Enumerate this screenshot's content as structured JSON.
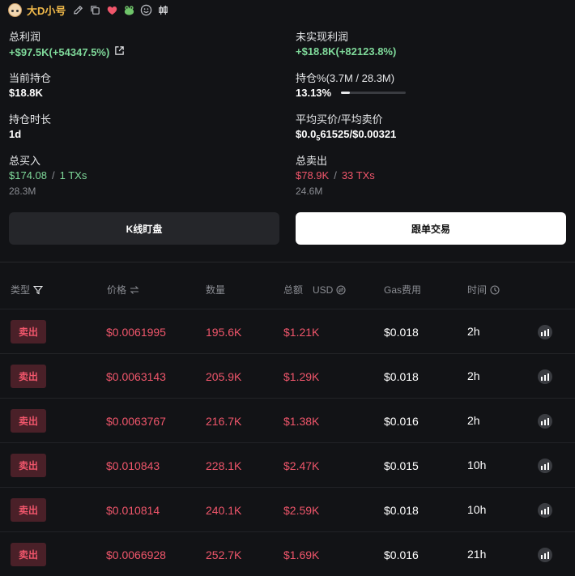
{
  "header": {
    "username": "大D小号"
  },
  "stats": {
    "total_profit": {
      "label": "总利润",
      "value": "+$97.5K(+54347.5%)"
    },
    "unrealized_profit": {
      "label": "未实现利润",
      "value": "+$18.8K(+82123.8%)"
    },
    "holding": {
      "label": "当前持仓",
      "value": "$18.8K"
    },
    "holding_pct": {
      "label_main": "持仓%",
      "label_detail": "(3.7M / 28.3M)",
      "value": "13.13%",
      "fraction": 0.1313
    },
    "hold_duration": {
      "label": "持仓时长",
      "value": "1d"
    },
    "avg_price": {
      "label": "平均买价/平均卖价",
      "value_prefix": "$0.0",
      "value_sub": "5",
      "value_rest": "61525/$0.00321"
    },
    "total_buy": {
      "label": "总买入",
      "amount": "$174.08",
      "sep": "/",
      "txs": "1 TXs",
      "qty": "28.3M"
    },
    "total_sell": {
      "label": "总卖出",
      "amount": "$78.9K",
      "sep": "/",
      "txs": "33 TXs",
      "qty": "24.6M"
    }
  },
  "buttons": {
    "kline": "K线盯盘",
    "copy_trade": "跟单交易"
  },
  "table": {
    "headers": {
      "type": "类型",
      "price": "价格",
      "amount": "数量",
      "total": "总额",
      "total_unit": "USD",
      "gas": "Gas费用",
      "time": "时间"
    },
    "rows": [
      {
        "type": "卖出",
        "price": "$0.0061995",
        "amount": "195.6K",
        "total": "$1.21K",
        "gas": "$0.018",
        "time": "2h"
      },
      {
        "type": "卖出",
        "price": "$0.0063143",
        "amount": "205.9K",
        "total": "$1.29K",
        "gas": "$0.018",
        "time": "2h"
      },
      {
        "type": "卖出",
        "price": "$0.0063767",
        "amount": "216.7K",
        "total": "$1.38K",
        "gas": "$0.016",
        "time": "2h"
      },
      {
        "type": "卖出",
        "price": "$0.010843",
        "amount": "228.1K",
        "total": "$2.47K",
        "gas": "$0.015",
        "time": "10h"
      },
      {
        "type": "卖出",
        "price": "$0.010814",
        "amount": "240.1K",
        "total": "$2.59K",
        "gas": "$0.018",
        "time": "10h"
      },
      {
        "type": "卖出",
        "price": "$0.0066928",
        "amount": "252.7K",
        "total": "$1.69K",
        "gas": "$0.016",
        "time": "21h"
      }
    ]
  },
  "colors": {
    "profit_green": "#7fd99a",
    "sell_red": "#f0566b",
    "username_gold": "#f0b94a",
    "background": "#121316"
  },
  "icons": {
    "header": [
      "avatar",
      "edit-icon",
      "copy-icon",
      "heart-icon",
      "frog-icon",
      "smiley-icon",
      "candlestick-icon"
    ],
    "row_action": "trend-chart-icon"
  }
}
